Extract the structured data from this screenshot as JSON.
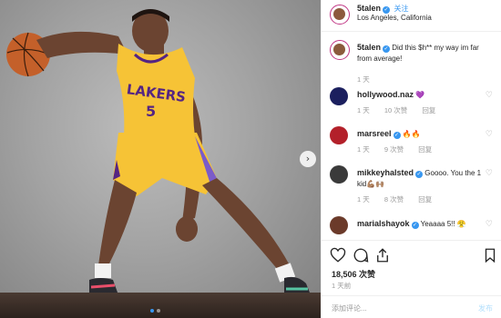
{
  "post": {
    "username": "5talen",
    "follow_label": "关注",
    "location": "Los Angeles, California",
    "verified_glyph": "✓",
    "caption": "Did this $h** my way im far from average!",
    "caption_time": "1 天",
    "jersey_text": "LAKERS",
    "jersey_number": "5"
  },
  "comments": [
    {
      "username": "hollywood.naz",
      "verified": false,
      "text": "💜",
      "time": "1 天",
      "likes": "10 次赞",
      "reply": "回复",
      "avatar_color": "#1b1f5e"
    },
    {
      "username": "marsreel",
      "verified": true,
      "text": "🔥🔥",
      "time": "1 天",
      "likes": "9 次赞",
      "reply": "回复",
      "avatar_color": "#b3202a"
    },
    {
      "username": "mikkeyhalsted",
      "verified": true,
      "text": "Goooo. You the 1 kid💪🏽🙌🏽",
      "time": "1 天",
      "likes": "8 次赞",
      "reply": "回复",
      "avatar_color": "#3a3a3a"
    },
    {
      "username": "marialshayok",
      "verified": true,
      "text": "Yeaaaa 5!! 😤",
      "time": "",
      "likes": "",
      "reply": "",
      "avatar_color": "#6b3a2a"
    }
  ],
  "actions": {
    "likes": "18,506 次赞",
    "time": "1 天前",
    "comment_placeholder": "添加评论...",
    "post_label": "发布"
  },
  "icons": {
    "next": "›",
    "small_heart": "♡",
    "like": "heart-icon",
    "comment": "comment-icon",
    "share": "share-icon",
    "save": "bookmark-icon"
  },
  "colors": {
    "link": "#3897f0",
    "muted": "#999999",
    "jersey": "#f6c336",
    "jersey_trim": "#552583"
  }
}
